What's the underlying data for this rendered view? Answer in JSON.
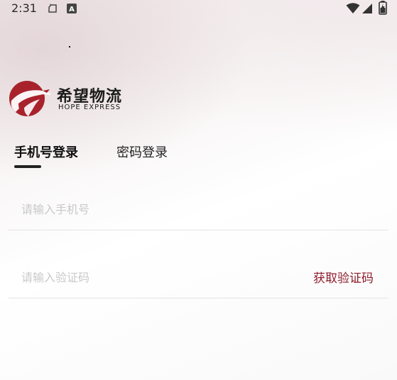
{
  "status_bar": {
    "time": "2:31",
    "indicator_letter": "A",
    "icons": [
      "cloud-sync-icon",
      "a-badge-icon",
      "wifi-icon",
      "signal-icon",
      "battery-icon"
    ]
  },
  "brand": {
    "name_cn": "希望物流",
    "name_en": "HOPE EXPRESS",
    "accent_color": "#a8222c"
  },
  "tabs": [
    {
      "label": "手机号登录",
      "active": true
    },
    {
      "label": "密码登录",
      "active": false
    }
  ],
  "form": {
    "phone_placeholder": "请输入手机号",
    "phone_value": "",
    "code_placeholder": "请输入验证码",
    "code_value": "",
    "get_code_label": "获取验证码",
    "get_code_color": "#8e1d2b"
  }
}
